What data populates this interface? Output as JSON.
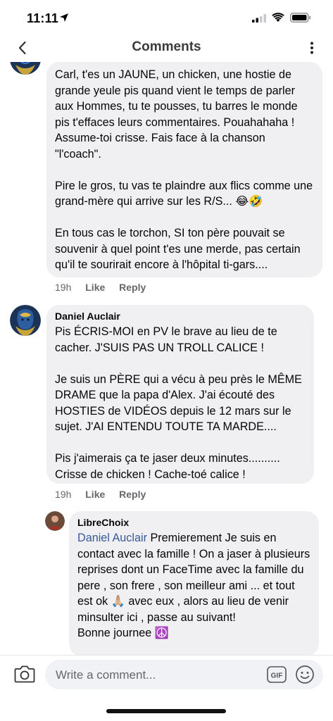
{
  "status": {
    "time": "11:11"
  },
  "header": {
    "title": "Comments"
  },
  "comments": [
    {
      "author": "",
      "text": "Carl, t'es un JAUNE, un chicken, une hostie de grande yeule pis quand vient le temps de parler aux Hommes, tu te pousses, tu barres le monde pis t'effaces leurs commentaires. Pouahahaha ! Assume-toi crisse. Fais face à la chanson \"l'coach\".\n\nPire le gros, tu vas te plaindre aux flics comme une grand-mère qui arrive sur les R/S... 😂🤣\n\nEn tous cas le torchon, SI ton père pouvait se souvenir à quel point t'es une merde, pas certain qu'il te sourirait encore à l'hôpital ti-gars....",
      "time": "19h",
      "like": "Like",
      "reply": "Reply"
    },
    {
      "author": "Daniel Auclair",
      "text": "Pis ÉCRIS-MOI en PV le brave au lieu de te cacher. J'SUIS PAS UN TROLL CALICE !\n\nJe suis un PÈRE qui a vécu à peu près le MÊME DRAME que la papa d'Alex. J'ai écouté des HOSTIES de VIDÉOS depuis le 12 mars sur le sujet. J'AI ENTENDU TOUTE TA MARDE....\n\nPis j'aimerais ça te jaser deux minutes..........\nCrisse de chicken ! Cache-toé calice !",
      "time": "19h",
      "like": "Like",
      "reply": "Reply"
    },
    {
      "author": "LibreChoix",
      "mention": "Daniel Auclair",
      "text": " Premierement Je suis en contact avec la famille ! On a jaser à plusieurs reprises dont un FaceTime avec la famille du pere , son frere , son meilleur ami ... et tout est ok 🙏🏼 avec eux , alors au lieu de venir minsulter ici , passe au suivant!\nBonne journee ☮️"
    }
  ],
  "composer": {
    "placeholder": "Write a comment..."
  },
  "icons": [
    "location-arrow-icon",
    "signal-icon",
    "wifi-icon",
    "battery-icon",
    "back-chevron-icon",
    "more-vertical-icon",
    "camera-icon",
    "gif-icon",
    "emoji-icon"
  ],
  "colors": {
    "bubble": "#f0f0f3",
    "mention": "#385898",
    "meta": "#65676b"
  }
}
